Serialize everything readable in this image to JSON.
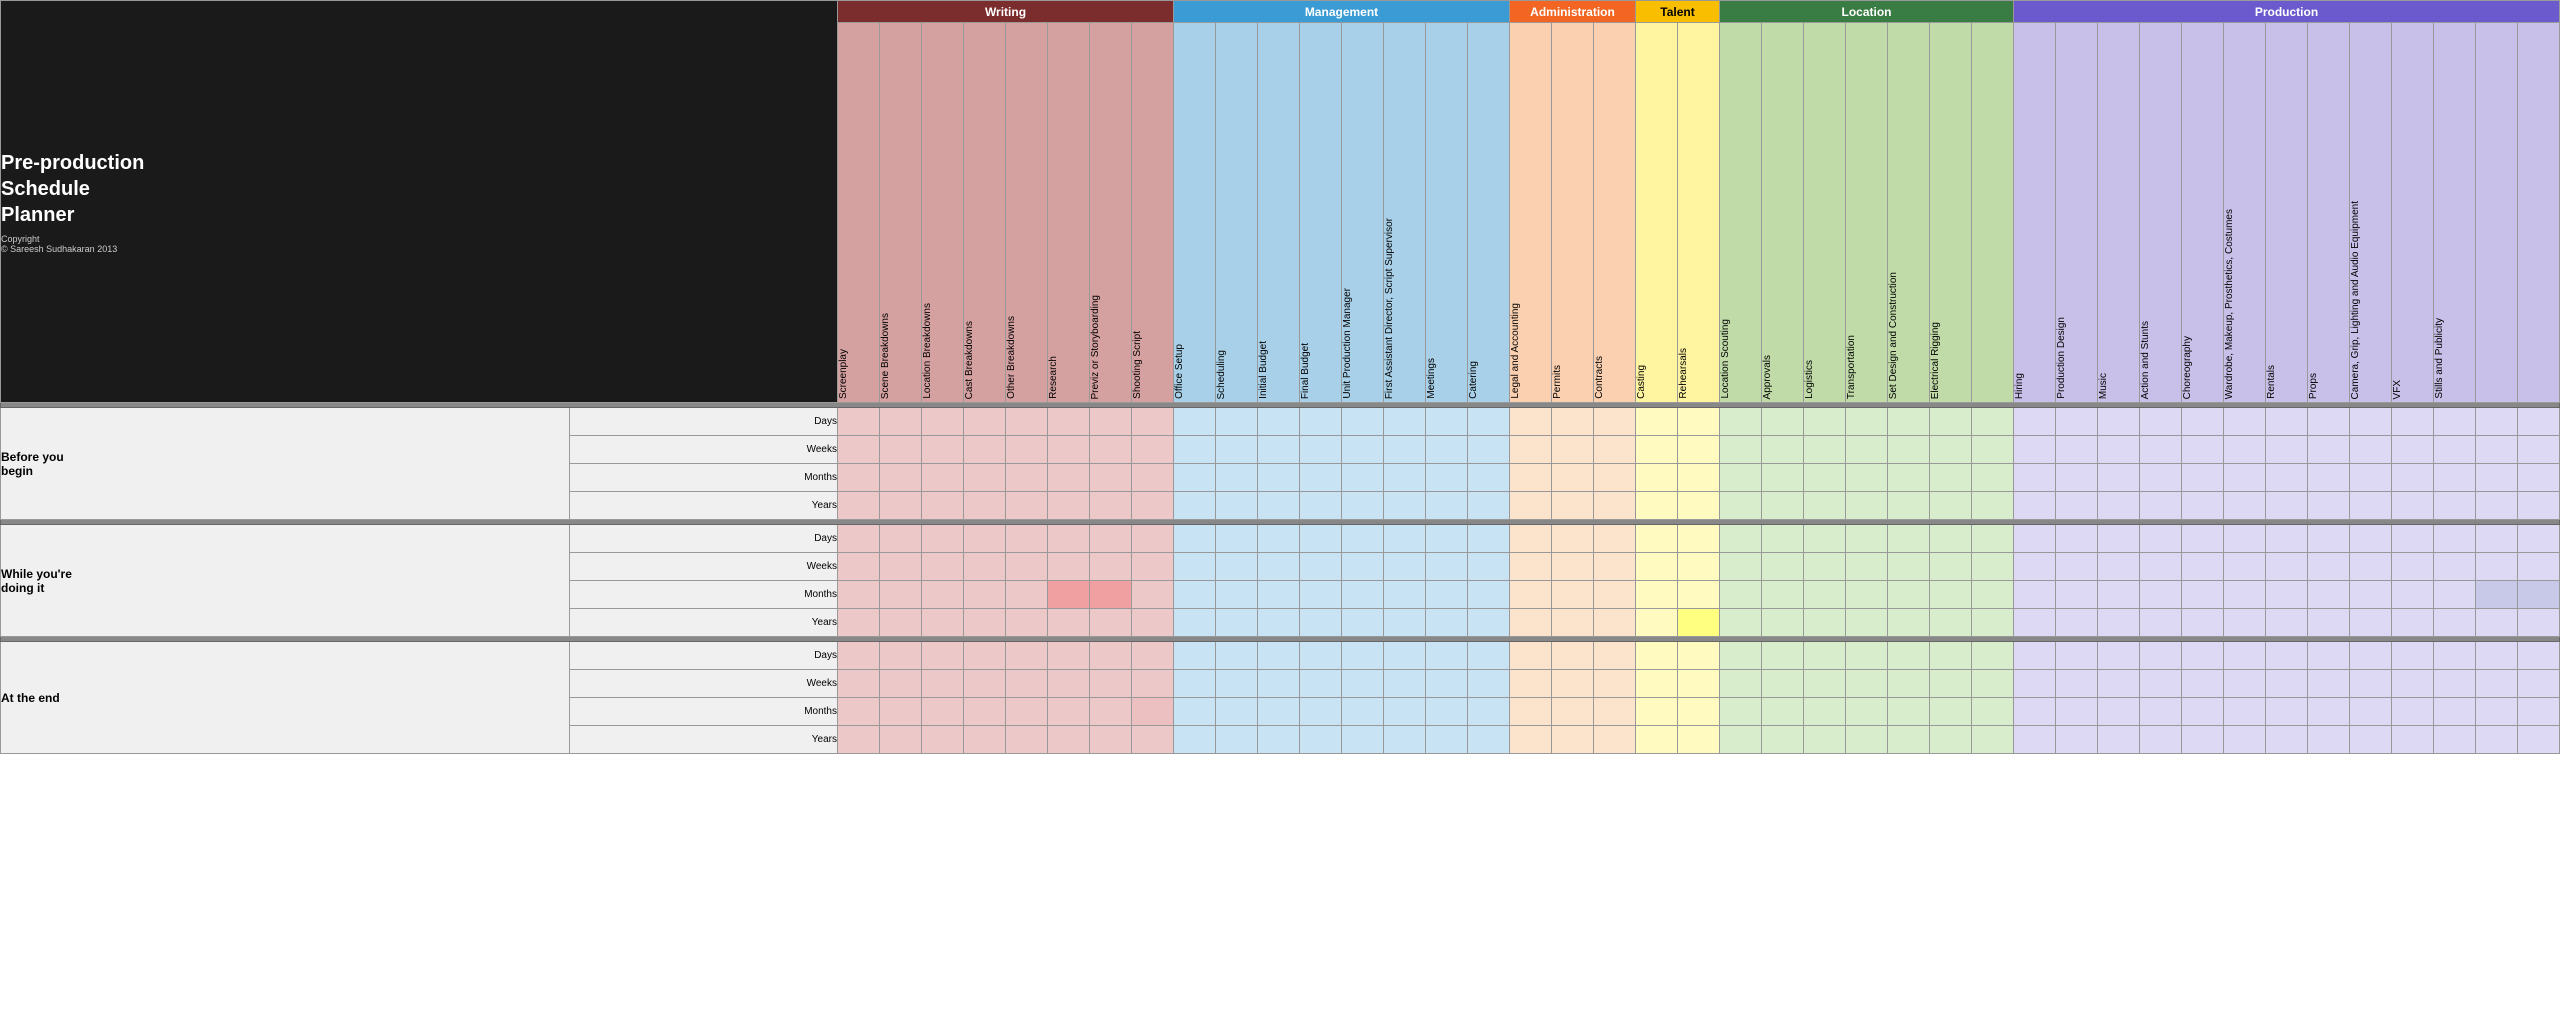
{
  "title": {
    "line1": "Pre-production",
    "line2": "Schedule",
    "line3": "Planner",
    "copyright": "Copyright",
    "author": "© Sareesh    Sudhakaran 2013"
  },
  "categories": [
    {
      "label": "Writing",
      "class": "cat-writing",
      "colspan": 9
    },
    {
      "label": "Management",
      "class": "cat-management",
      "colspan": 9
    },
    {
      "label": "Administration",
      "class": "cat-administration",
      "colspan": 3
    },
    {
      "label": "Talent",
      "class": "cat-talent",
      "colspan": 2
    },
    {
      "label": "Location",
      "class": "cat-location",
      "colspan": 8
    },
    {
      "label": "Production",
      "class": "cat-production",
      "colspan": 13
    }
  ],
  "columns": [
    {
      "label": "Screenplay",
      "class": "ch-writing"
    },
    {
      "label": "Scene Breakdowns",
      "class": "ch-writing"
    },
    {
      "label": "Location Breakdowns",
      "class": "ch-writing"
    },
    {
      "label": "Cast Breakdowns",
      "class": "ch-writing"
    },
    {
      "label": "Other Breakdowns",
      "class": "ch-writing"
    },
    {
      "label": "Research",
      "class": "ch-writing"
    },
    {
      "label": "Previz or Storyboarding",
      "class": "ch-writing"
    },
    {
      "label": "Shooting Script",
      "class": "ch-writing"
    },
    {
      "label": "Office Setup",
      "class": "ch-management"
    },
    {
      "label": "Scheduling",
      "class": "ch-management"
    },
    {
      "label": "Initial Budget",
      "class": "ch-management"
    },
    {
      "label": "Final Budget",
      "class": "ch-management"
    },
    {
      "label": "Unit Production Manager",
      "class": "ch-management"
    },
    {
      "label": "First Assistant Director, Script Supervisor",
      "class": "ch-management"
    },
    {
      "label": "Meetings",
      "class": "ch-management"
    },
    {
      "label": "Catering",
      "class": "ch-management"
    },
    {
      "label": "Legal and Accounting",
      "class": "ch-administration"
    },
    {
      "label": "Permits",
      "class": "ch-administration"
    },
    {
      "label": "Contracts",
      "class": "ch-administration"
    },
    {
      "label": "Casting",
      "class": "ch-talent"
    },
    {
      "label": "Rehearsals",
      "class": "ch-talent"
    },
    {
      "label": "Location Scouting",
      "class": "ch-location"
    },
    {
      "label": "Approvals",
      "class": "ch-location"
    },
    {
      "label": "Logistics",
      "class": "ch-location"
    },
    {
      "label": "Transportation",
      "class": "ch-location"
    },
    {
      "label": "Set Design and Construction",
      "class": "ch-location"
    },
    {
      "label": "Electrical Rigging",
      "class": "ch-location"
    },
    {
      "label": "Hiring",
      "class": "ch-production"
    },
    {
      "label": "Production Design",
      "class": "ch-production"
    },
    {
      "label": "Music",
      "class": "ch-production"
    },
    {
      "label": "Action and Stunts",
      "class": "ch-production"
    },
    {
      "label": "Choreography",
      "class": "ch-production"
    },
    {
      "label": "Wardrobe, Makeup, Prosthetics, Costumes",
      "class": "ch-production"
    },
    {
      "label": "Rentals",
      "class": "ch-production"
    },
    {
      "label": "Props",
      "class": "ch-production"
    },
    {
      "label": "Camera, Grip, Lighting and Audio Equipment",
      "class": "ch-production"
    },
    {
      "label": "VFX",
      "class": "ch-production"
    },
    {
      "label": "Stills and Publicity",
      "class": "ch-production"
    },
    {
      "label": "",
      "class": "ch-production"
    },
    {
      "label": "",
      "class": "ch-production"
    }
  ],
  "row_groups": [
    {
      "group_label": "Before you begin",
      "rows": [
        "Days",
        "Weeks",
        "Months",
        "Years"
      ]
    },
    {
      "group_label": "While you're doing it",
      "rows": [
        "Days",
        "Weeks",
        "Months",
        "Years"
      ]
    },
    {
      "group_label": "At the end",
      "rows": [
        "Days",
        "Weeks",
        "Months",
        "Years"
      ]
    }
  ]
}
